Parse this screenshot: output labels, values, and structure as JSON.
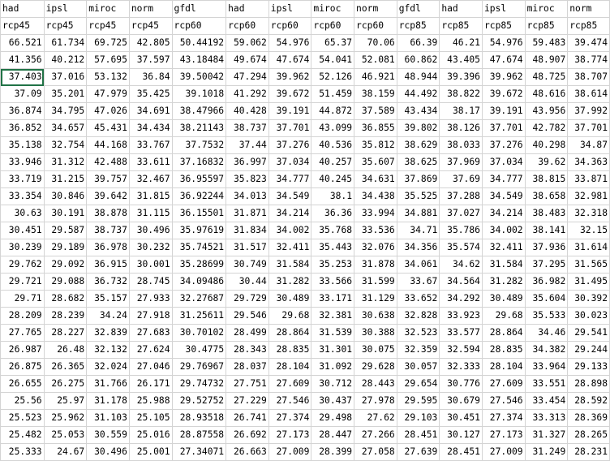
{
  "sheet": {
    "rows": [
      [
        "had",
        "ipsl",
        "miroc",
        "norm",
        "gfdl",
        "had",
        "ipsl",
        "miroc",
        "norm",
        "gfdl",
        "had",
        "ipsl",
        "miroc",
        "norm"
      ],
      [
        "rcp45",
        "rcp45",
        "rcp45",
        "rcp45",
        "rcp60",
        "rcp60",
        "rcp60",
        "rcp60",
        "rcp60",
        "rcp85",
        "rcp85",
        "rcp85",
        "rcp85",
        "rcp85"
      ],
      [
        "66.521",
        "61.734",
        "69.725",
        "42.805",
        "50.44192",
        "59.062",
        "54.976",
        "65.37",
        "70.06",
        "66.39",
        "46.21",
        "54.976",
        "59.483",
        "39.474"
      ],
      [
        "41.356",
        "40.212",
        "57.695",
        "37.597",
        "43.18484",
        "49.674",
        "47.674",
        "54.041",
        "52.081",
        "60.862",
        "43.405",
        "47.674",
        "48.907",
        "38.774"
      ],
      [
        "37.403",
        "37.016",
        "53.132",
        "36.84",
        "39.50042",
        "47.294",
        "39.962",
        "52.126",
        "46.921",
        "48.944",
        "39.396",
        "39.962",
        "48.725",
        "38.707"
      ],
      [
        "37.09",
        "35.201",
        "47.979",
        "35.425",
        "39.1018",
        "41.292",
        "39.672",
        "51.459",
        "38.159",
        "44.492",
        "38.822",
        "39.672",
        "48.616",
        "38.614"
      ],
      [
        "36.874",
        "34.795",
        "47.026",
        "34.691",
        "38.47966",
        "40.428",
        "39.191",
        "44.872",
        "37.589",
        "43.434",
        "38.17",
        "39.191",
        "43.956",
        "37.992"
      ],
      [
        "36.852",
        "34.657",
        "45.431",
        "34.434",
        "38.21143",
        "38.737",
        "37.701",
        "43.099",
        "36.855",
        "39.802",
        "38.126",
        "37.701",
        "42.782",
        "37.701"
      ],
      [
        "35.138",
        "32.754",
        "44.168",
        "33.767",
        "37.7532",
        "37.44",
        "37.276",
        "40.536",
        "35.812",
        "38.629",
        "38.033",
        "37.276",
        "40.298",
        "34.87"
      ],
      [
        "33.946",
        "31.312",
        "42.488",
        "33.611",
        "37.16832",
        "36.997",
        "37.034",
        "40.257",
        "35.607",
        "38.625",
        "37.969",
        "37.034",
        "39.62",
        "34.363"
      ],
      [
        "33.719",
        "31.215",
        "39.757",
        "32.467",
        "36.95597",
        "35.823",
        "34.777",
        "40.245",
        "34.631",
        "37.869",
        "37.69",
        "34.777",
        "38.815",
        "33.871"
      ],
      [
        "33.354",
        "30.846",
        "39.642",
        "31.815",
        "36.92244",
        "34.013",
        "34.549",
        "38.1",
        "34.438",
        "35.525",
        "37.288",
        "34.549",
        "38.658",
        "32.981"
      ],
      [
        "30.63",
        "30.191",
        "38.878",
        "31.115",
        "36.15501",
        "31.871",
        "34.214",
        "36.36",
        "33.994",
        "34.881",
        "37.027",
        "34.214",
        "38.483",
        "32.318"
      ],
      [
        "30.451",
        "29.587",
        "38.737",
        "30.496",
        "35.97619",
        "31.834",
        "34.002",
        "35.768",
        "33.536",
        "34.71",
        "35.786",
        "34.002",
        "38.141",
        "32.15"
      ],
      [
        "30.239",
        "29.189",
        "36.978",
        "30.232",
        "35.74521",
        "31.517",
        "32.411",
        "35.443",
        "32.076",
        "34.356",
        "35.574",
        "32.411",
        "37.936",
        "31.614"
      ],
      [
        "29.762",
        "29.092",
        "36.915",
        "30.001",
        "35.28699",
        "30.749",
        "31.584",
        "35.253",
        "31.878",
        "34.061",
        "34.62",
        "31.584",
        "37.295",
        "31.565"
      ],
      [
        "29.721",
        "29.088",
        "36.732",
        "28.745",
        "34.09486",
        "30.44",
        "31.282",
        "33.566",
        "31.599",
        "33.67",
        "34.564",
        "31.282",
        "36.982",
        "31.495"
      ],
      [
        "29.71",
        "28.682",
        "35.157",
        "27.933",
        "32.27687",
        "29.729",
        "30.489",
        "33.171",
        "31.129",
        "33.652",
        "34.292",
        "30.489",
        "35.604",
        "30.392"
      ],
      [
        "28.209",
        "28.239",
        "34.24",
        "27.918",
        "31.25611",
        "29.546",
        "29.68",
        "32.381",
        "30.638",
        "32.828",
        "33.923",
        "29.68",
        "35.533",
        "30.023"
      ],
      [
        "27.765",
        "28.227",
        "32.839",
        "27.683",
        "30.70102",
        "28.499",
        "28.864",
        "31.539",
        "30.388",
        "32.523",
        "33.577",
        "28.864",
        "34.46",
        "29.541"
      ],
      [
        "26.987",
        "26.48",
        "32.132",
        "27.624",
        "30.4775",
        "28.343",
        "28.835",
        "31.301",
        "30.075",
        "32.359",
        "32.594",
        "28.835",
        "34.382",
        "29.244"
      ],
      [
        "26.875",
        "26.365",
        "32.024",
        "27.046",
        "29.76967",
        "28.037",
        "28.104",
        "31.092",
        "29.628",
        "30.057",
        "32.333",
        "28.104",
        "33.964",
        "29.133"
      ],
      [
        "26.655",
        "26.275",
        "31.766",
        "26.171",
        "29.74732",
        "27.751",
        "27.609",
        "30.712",
        "28.443",
        "29.654",
        "30.776",
        "27.609",
        "33.551",
        "28.898"
      ],
      [
        "25.56",
        "25.97",
        "31.178",
        "25.988",
        "29.52752",
        "27.229",
        "27.546",
        "30.437",
        "27.978",
        "29.595",
        "30.679",
        "27.546",
        "33.454",
        "28.592"
      ],
      [
        "25.523",
        "25.962",
        "31.103",
        "25.105",
        "28.93518",
        "26.741",
        "27.374",
        "29.498",
        "27.62",
        "29.103",
        "30.451",
        "27.374",
        "33.313",
        "28.369"
      ],
      [
        "25.482",
        "25.053",
        "30.559",
        "25.016",
        "28.87558",
        "26.692",
        "27.173",
        "28.447",
        "27.266",
        "28.451",
        "30.127",
        "27.173",
        "31.327",
        "28.265"
      ],
      [
        "25.333",
        "24.67",
        "30.496",
        "25.001",
        "27.34071",
        "26.663",
        "27.009",
        "28.399",
        "27.058",
        "27.639",
        "28.451",
        "27.009",
        "31.249",
        "28.231"
      ]
    ]
  }
}
